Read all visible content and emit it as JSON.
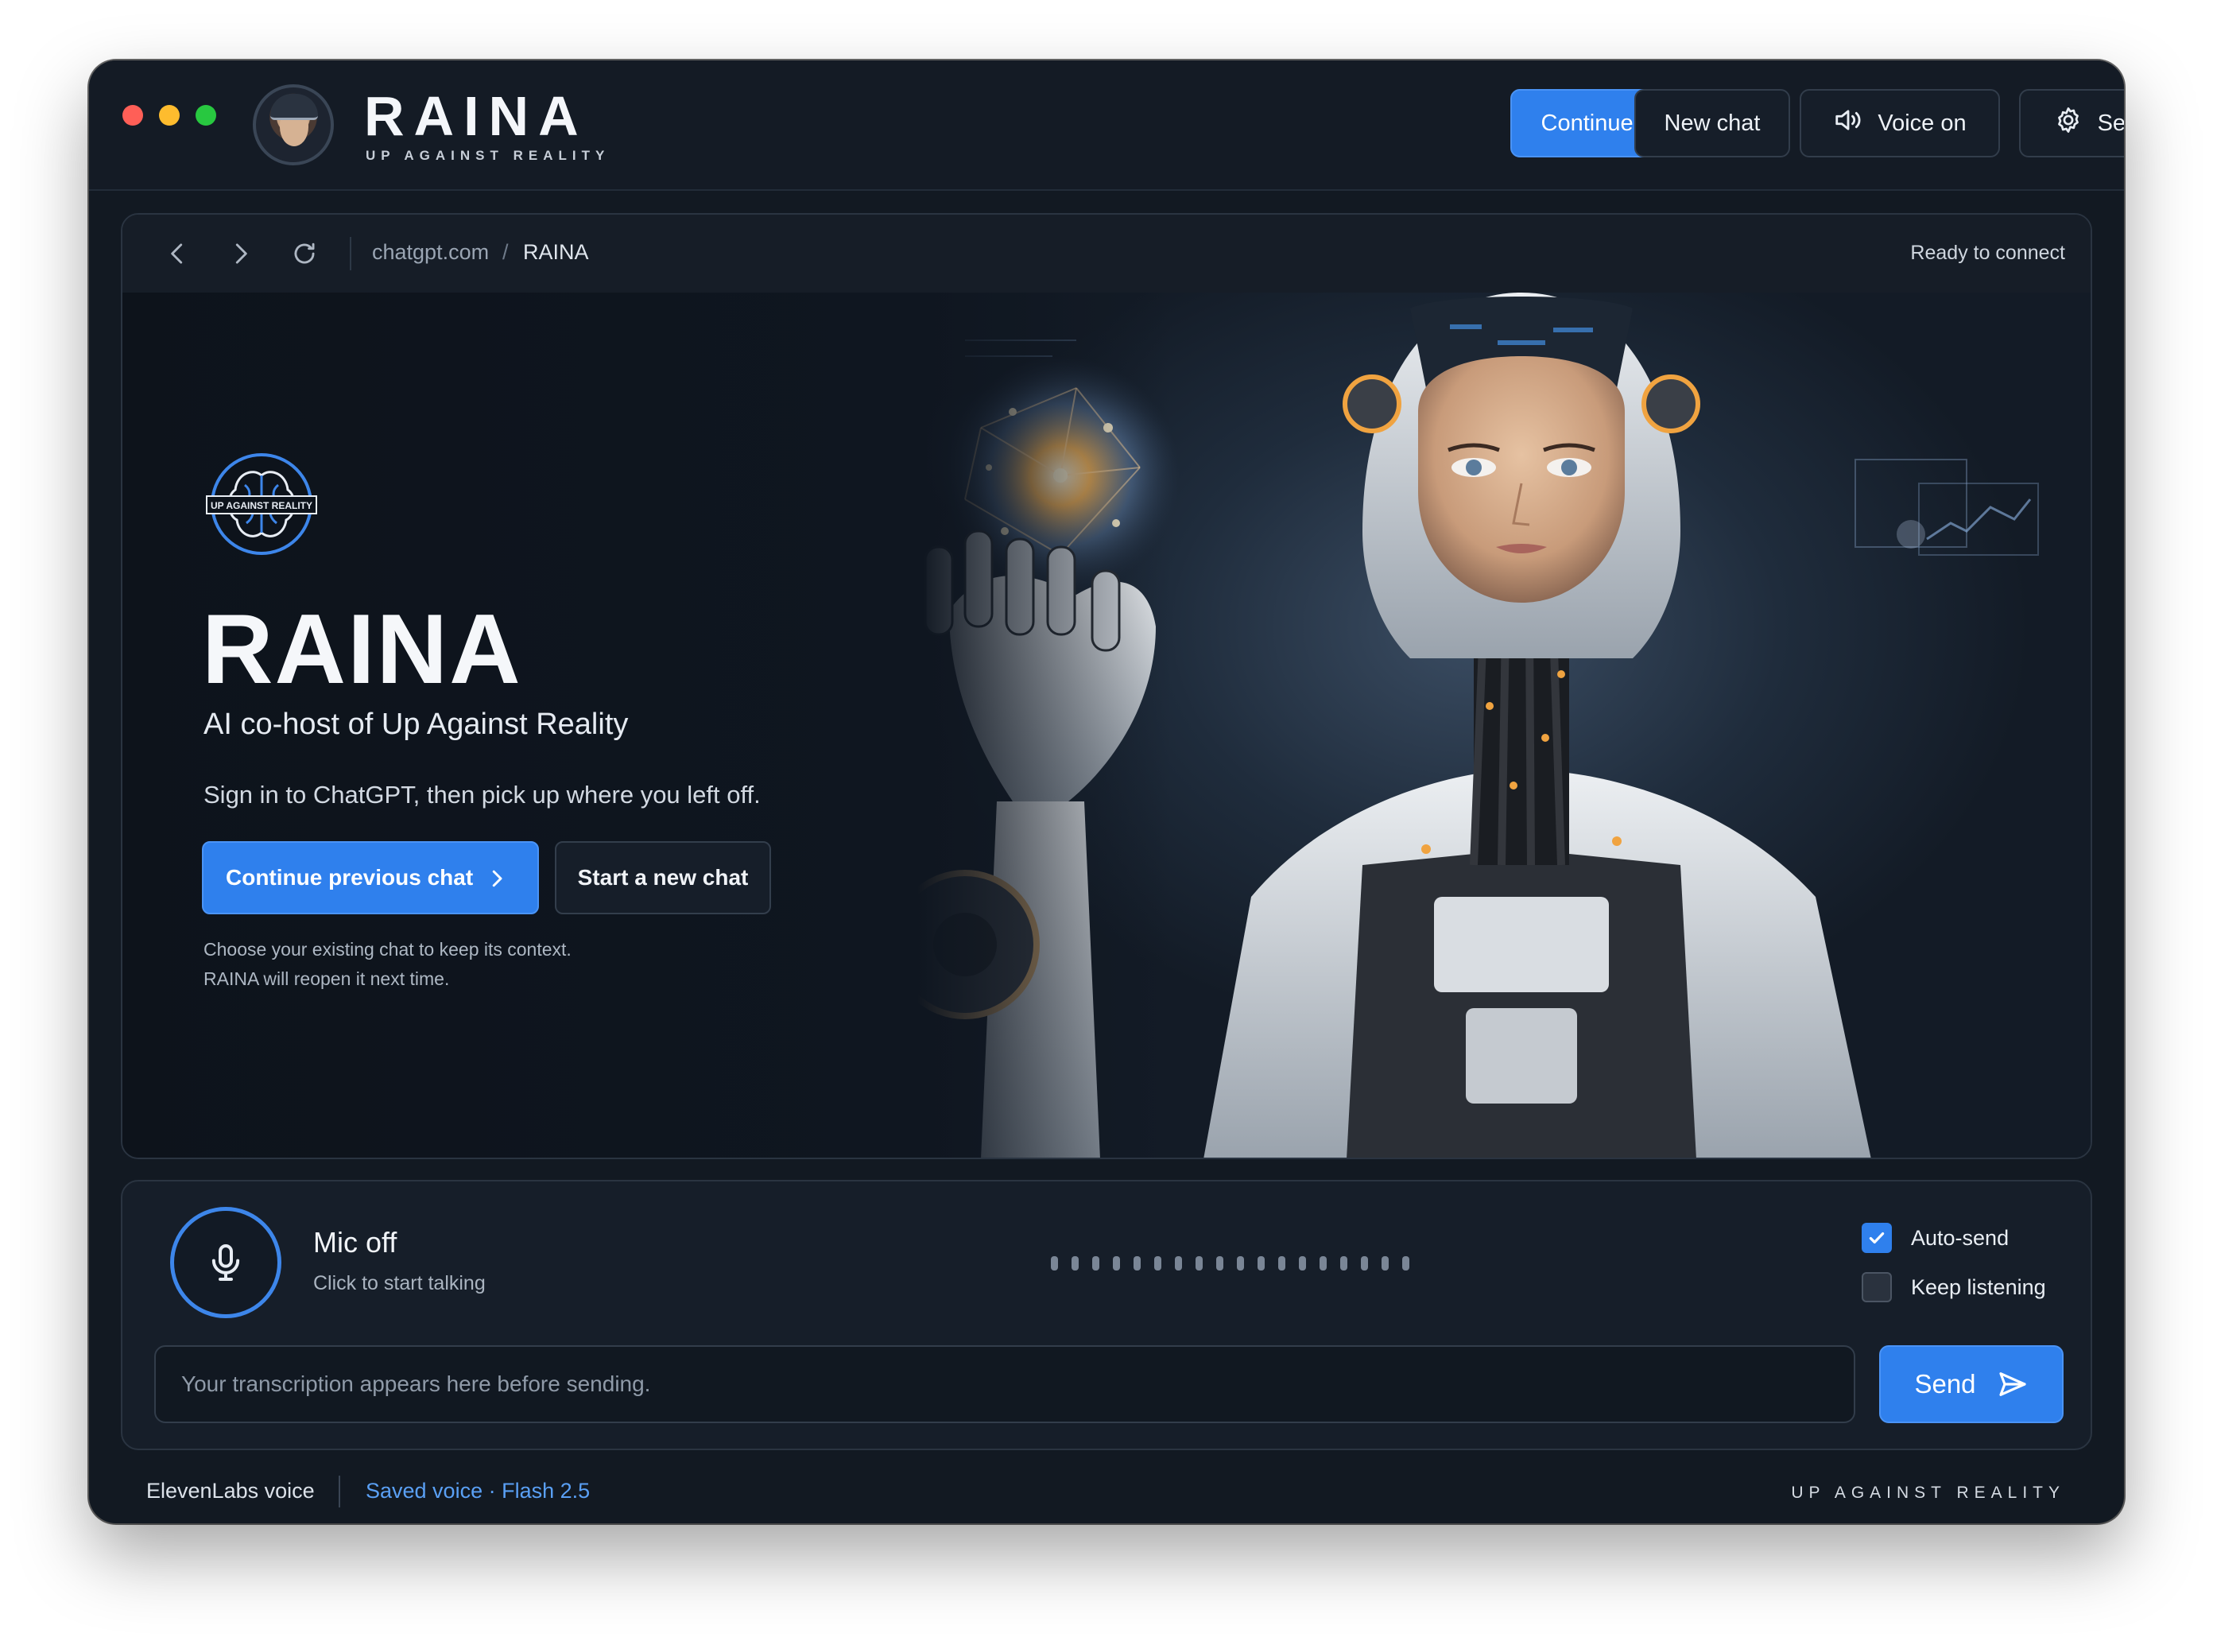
{
  "app": {
    "title": "RAINA",
    "subtitle": "UP AGAINST REALITY"
  },
  "toolbar": {
    "continue_chat": "Continue chat",
    "new_chat": "New chat",
    "voice": "Voice on",
    "settings": "Settings"
  },
  "browser": {
    "host": "chatgpt.com",
    "separator": "/",
    "page": "RAINA",
    "status": "Ready to connect"
  },
  "hero": {
    "badge_text": "UP AGAINST REALITY",
    "title": "RAINA",
    "subtitle": "AI co-host of Up Against Reality",
    "description": "Sign in to ChatGPT, then pick up where you left off.",
    "primary_cta": "Continue previous chat",
    "secondary_cta": "Start a new chat",
    "hint_line1": "Choose your existing chat to keep its context.",
    "hint_line2": "RAINA will reopen it next time."
  },
  "voice_panel": {
    "mic_status": "Mic off",
    "mic_hint": "Click to start talking",
    "auto_send": {
      "label": "Auto-send",
      "checked": true
    },
    "keep_listening": {
      "label": "Keep listening",
      "checked": false
    },
    "transcript_placeholder": "Your transcription appears here before sending.",
    "send_label": "Send"
  },
  "footer": {
    "voice_provider": "ElevenLabs voice",
    "voice_detail": "Saved voice · Flash 2.5",
    "brand": "UP AGAINST REALITY"
  },
  "colors": {
    "accent": "#2f80ed",
    "background": "#121922",
    "link": "#5aa0f5"
  },
  "icons": {
    "voice": "speaker-icon",
    "settings": "gear-icon",
    "mic": "microphone-icon",
    "send": "paper-plane-icon"
  }
}
